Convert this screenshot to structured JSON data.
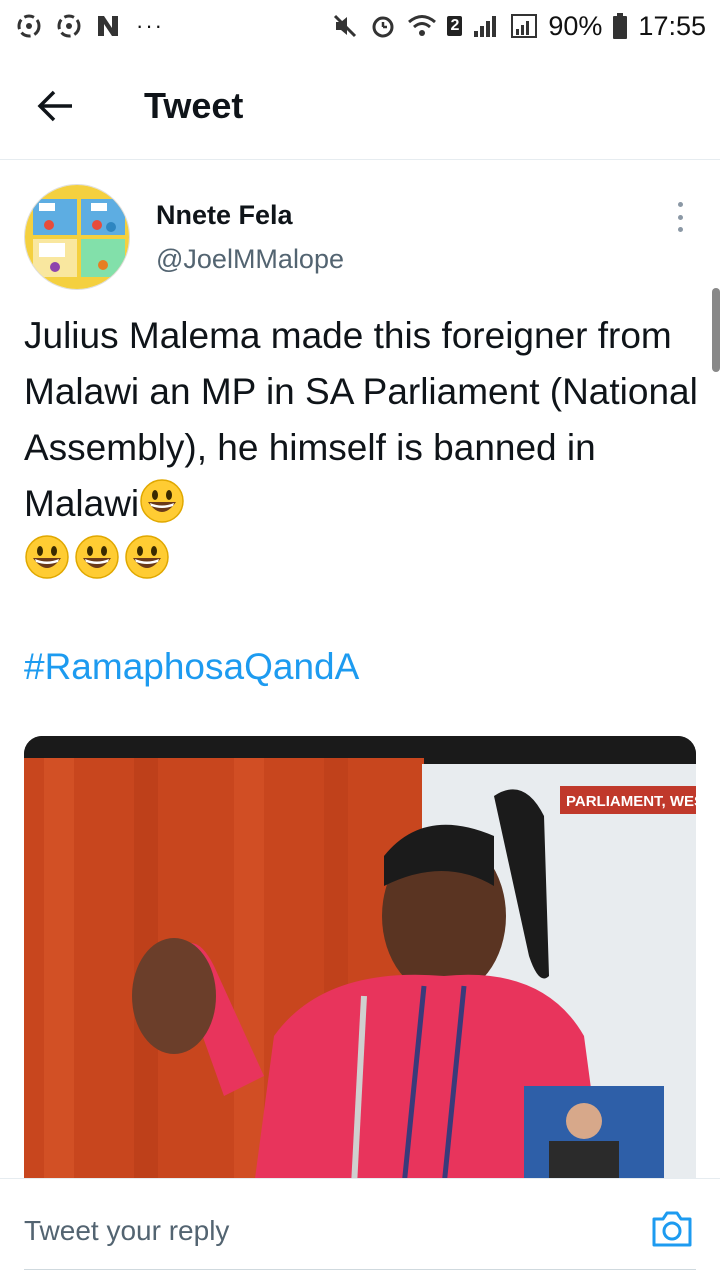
{
  "status_bar": {
    "battery": "90%",
    "time": "17:55",
    "sim_badge": "2",
    "dots": "···"
  },
  "header": {
    "title": "Tweet"
  },
  "tweet": {
    "display_name": "Nnete Fela",
    "handle": "@JoelMMalope",
    "text": "Julius Malema made this foreigner from Malawi an MP in SA Parliament (National Assembly), he himself is banned in Malawi",
    "emoji": "grinning-face-emoji",
    "trailing_emoji_count": 3,
    "hashtag": "#RamaphosaQandA",
    "media": {
      "overlay_text": "PARLIAMENT, WEST",
      "description_icon": "photo"
    }
  },
  "reply_bar": {
    "placeholder": "Tweet your reply",
    "camera_icon": "camera-icon"
  },
  "colors": {
    "link": "#1d9bf0",
    "muted": "#536471",
    "text": "#0f1419"
  }
}
